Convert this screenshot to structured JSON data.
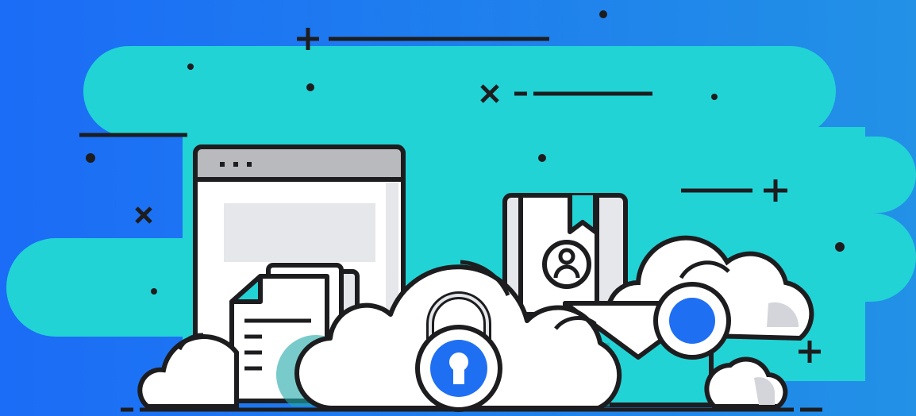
{
  "scene": {
    "subject": "cloud-security-illustration",
    "colors": {
      "background_left": "#1b6cf6",
      "background_right": "#2291e6",
      "cloud_band": "#22d3d6",
      "outline": "#1d1d1f",
      "white": "#ffffff",
      "light_gray": "#e6e7ea",
      "mid_gray": "#b9babe",
      "accent_blue": "#1f6ff2",
      "shadow_teal": "#1fa9a9"
    },
    "icons": [
      "browser-window-icon",
      "document-stack-icon",
      "padlock-icon",
      "contact-book-icon",
      "envelope-icon",
      "cloud-icon"
    ]
  }
}
